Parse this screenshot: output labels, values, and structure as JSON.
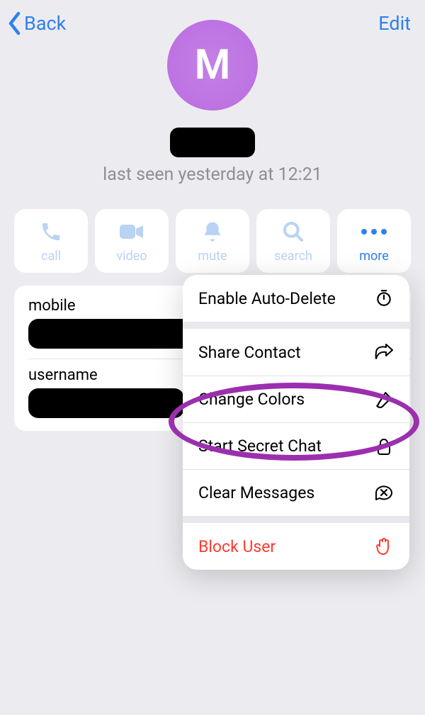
{
  "nav": {
    "back": "Back",
    "edit": "Edit"
  },
  "profile": {
    "avatar_initial": "M",
    "status": "last seen yesterday at 12:21"
  },
  "actions": {
    "call": {
      "label": "call"
    },
    "video": {
      "label": "video"
    },
    "mute": {
      "label": "mute"
    },
    "search": {
      "label": "search"
    },
    "more": {
      "label": "more"
    }
  },
  "info": {
    "mobile_label": "mobile",
    "username_label": "username"
  },
  "menu": {
    "auto_delete": "Enable Auto-Delete",
    "share_contact": "Share Contact",
    "change_colors": "Change Colors",
    "secret_chat": "Start Secret Chat",
    "clear_msgs": "Clear Messages",
    "block_user": "Block User"
  },
  "colors": {
    "accent": "#2F80ED",
    "danger": "#FF3B30",
    "highlight": "#9B2FAE"
  }
}
